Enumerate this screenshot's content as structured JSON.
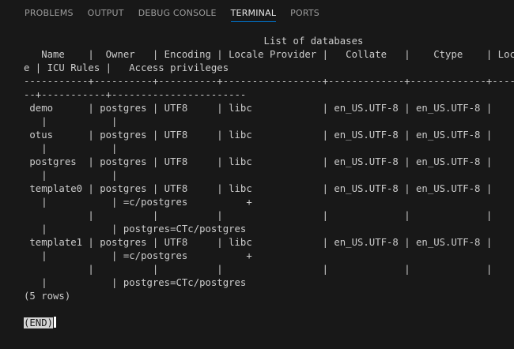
{
  "tabs": [
    {
      "label": "PROBLEMS",
      "active": false
    },
    {
      "label": "OUTPUT",
      "active": false
    },
    {
      "label": "DEBUG CONSOLE",
      "active": false
    },
    {
      "label": "TERMINAL",
      "active": true
    },
    {
      "label": "PORTS",
      "active": false
    }
  ],
  "terminal": {
    "lines": [
      "                                         List of databases",
      "   Name    |  Owner   | Encoding | Locale Provider |   Collate   |    Ctype    | Local",
      "e | ICU Rules |   Access privileges",
      "-----------+----------+----------+-----------------+-------------+-------------+------",
      "--+-----------+-----------------------",
      " demo      | postgres | UTF8     | libc            | en_US.UTF-8 | en_US.UTF-8 |",
      "   |           |",
      " otus      | postgres | UTF8     | libc            | en_US.UTF-8 | en_US.UTF-8 |",
      "   |           |",
      " postgres  | postgres | UTF8     | libc            | en_US.UTF-8 | en_US.UTF-8 |",
      "   |           |",
      " template0 | postgres | UTF8     | libc            | en_US.UTF-8 | en_US.UTF-8 |",
      "   |           | =c/postgres          +",
      "           |          |          |                 |             |             |",
      "   |           | postgres=CTc/postgres",
      " template1 | postgres | UTF8     | libc            | en_US.UTF-8 | en_US.UTF-8 |",
      "   |           | =c/postgres          +",
      "           |          |          |                 |             |             |",
      "   |           | postgres=CTc/postgres",
      "(5 rows)",
      ""
    ],
    "end_marker": "(END)"
  }
}
